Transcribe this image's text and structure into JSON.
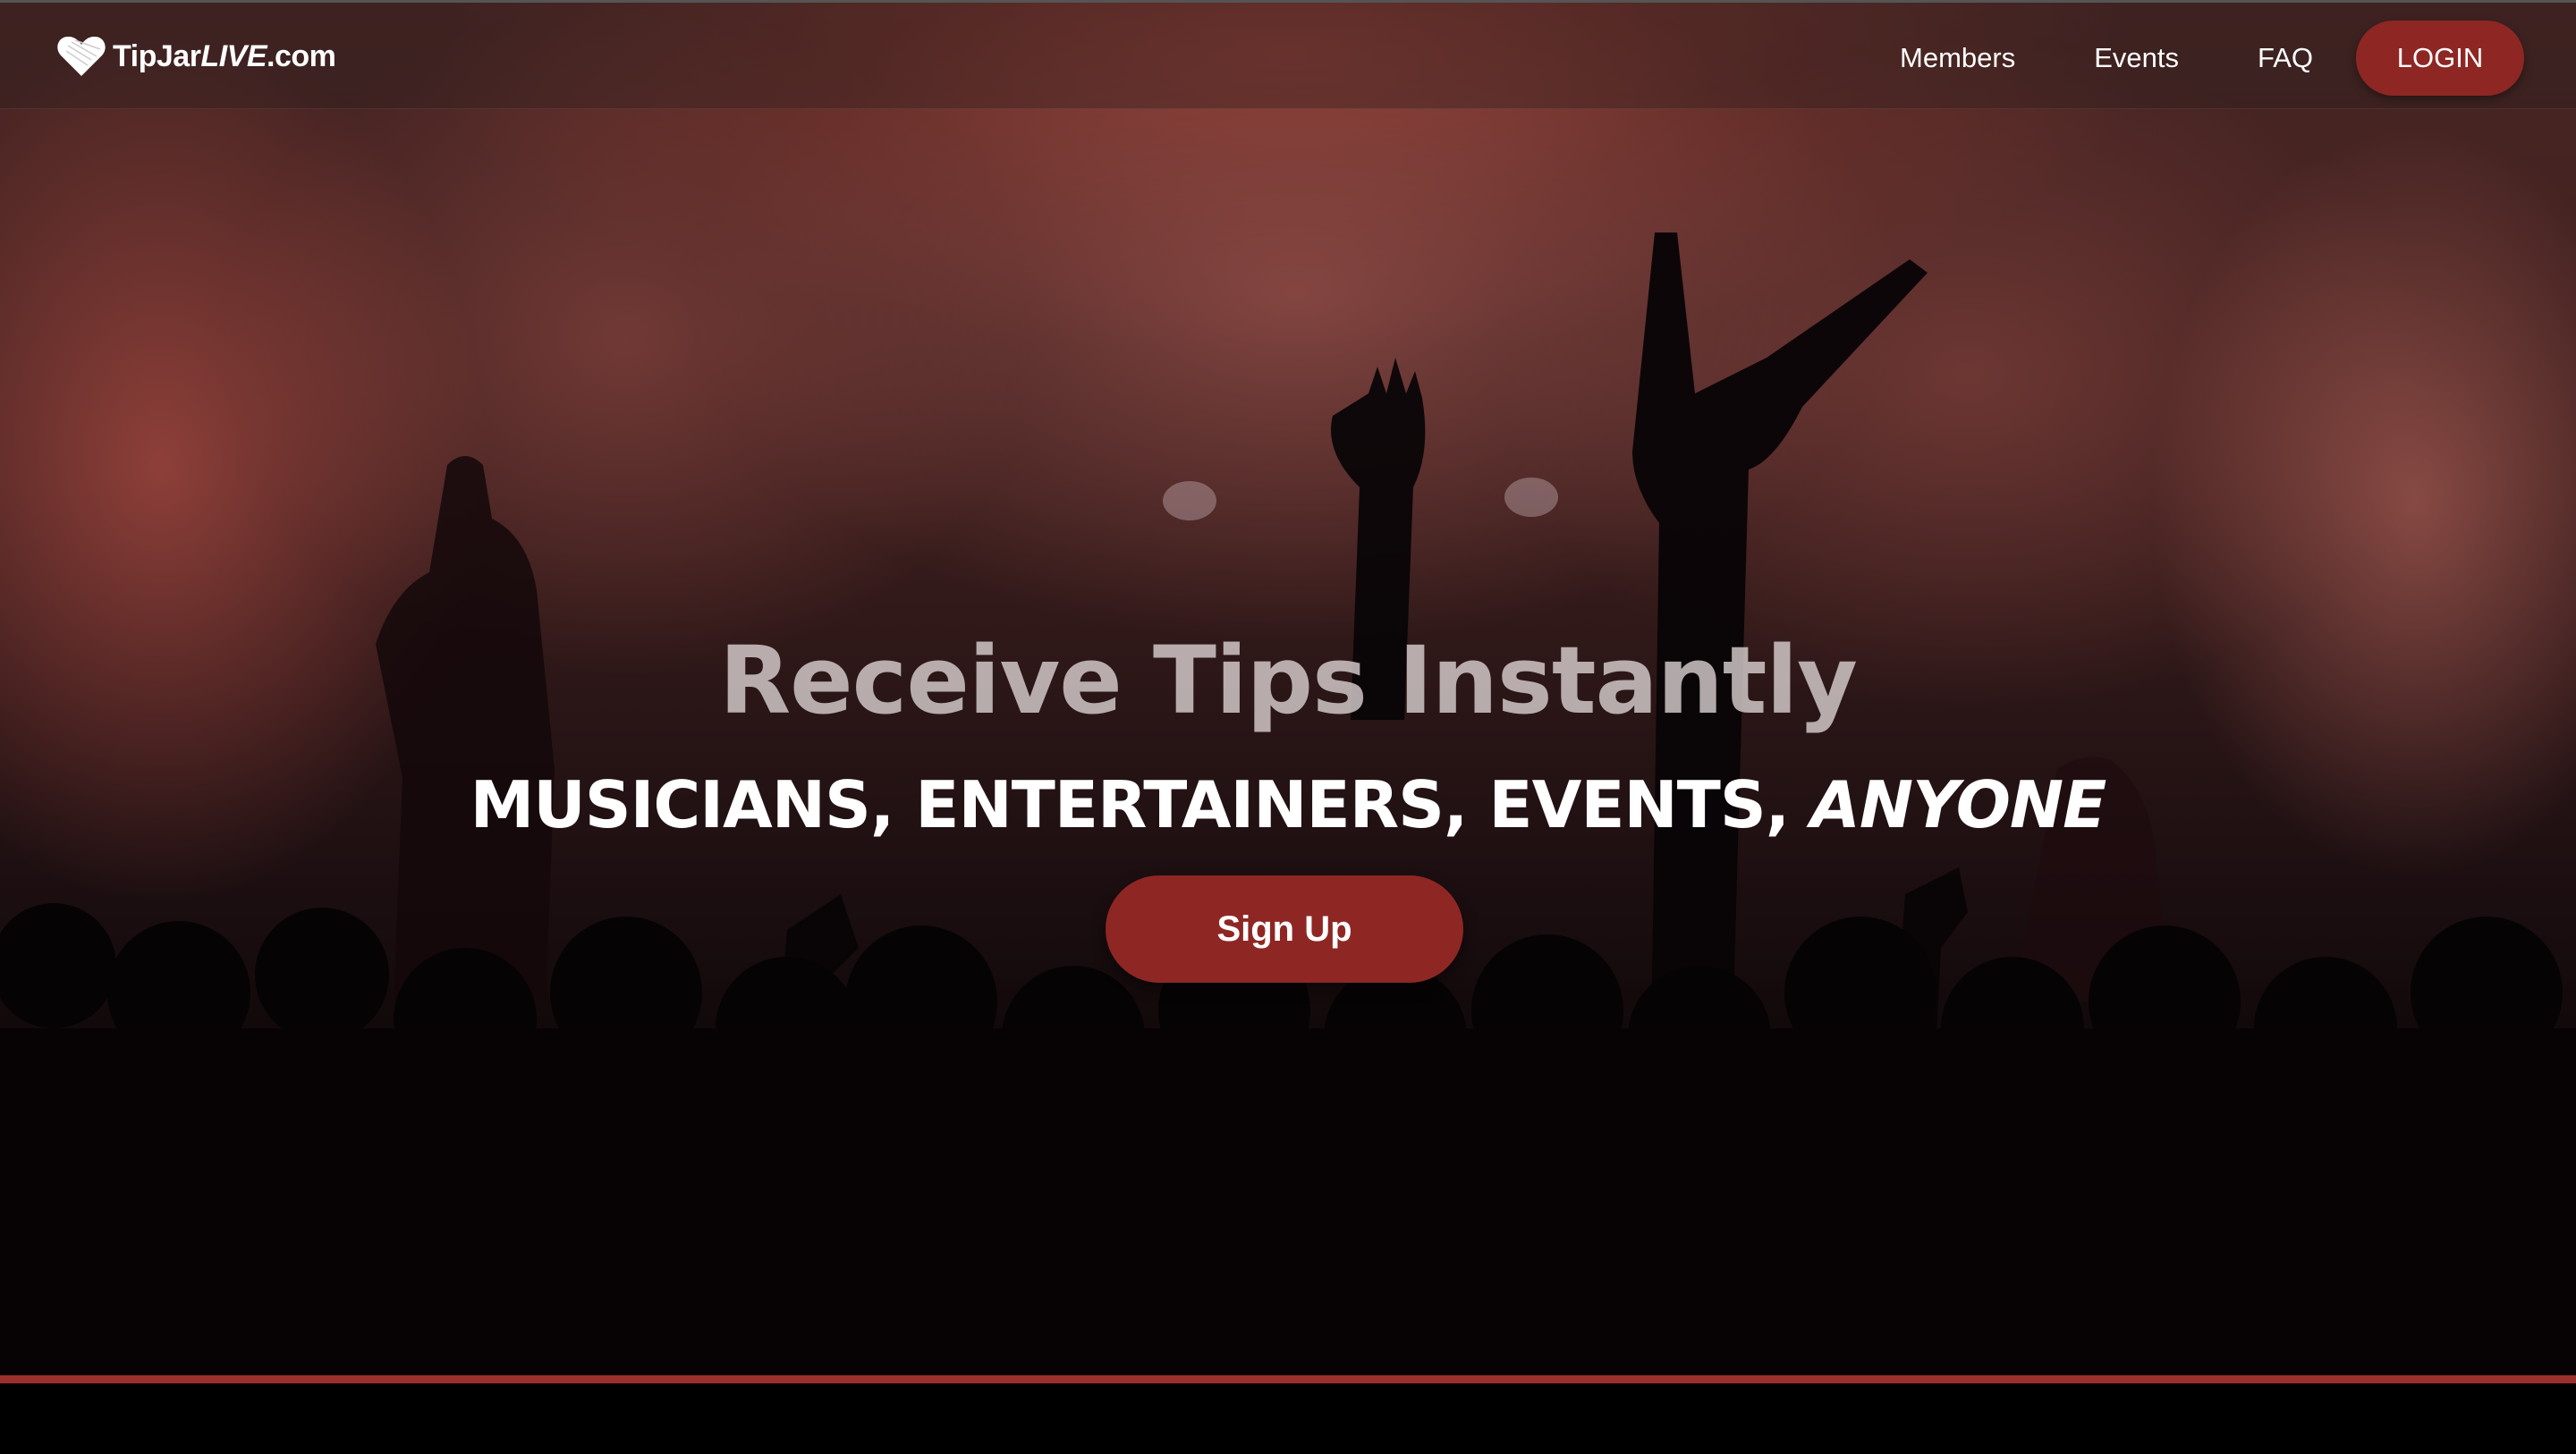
{
  "brand": {
    "logo_icon": "heart-icon",
    "name_prefix": "TipJar",
    "name_live": "LIVE",
    "name_suffix": ".com"
  },
  "nav": {
    "items": [
      {
        "label": "Members"
      },
      {
        "label": "Events"
      },
      {
        "label": "FAQ"
      }
    ],
    "login_label": "LOGIN"
  },
  "hero": {
    "headline": "Receive Tips Instantly",
    "subline_main": "MUSICIANS, ENTERTAINERS, EVENTS, ",
    "subline_emphasis": "ANYONE",
    "signup_label": "Sign Up"
  },
  "colors": {
    "accent": "#8e2724",
    "accent_line": "#9b2f2b"
  }
}
